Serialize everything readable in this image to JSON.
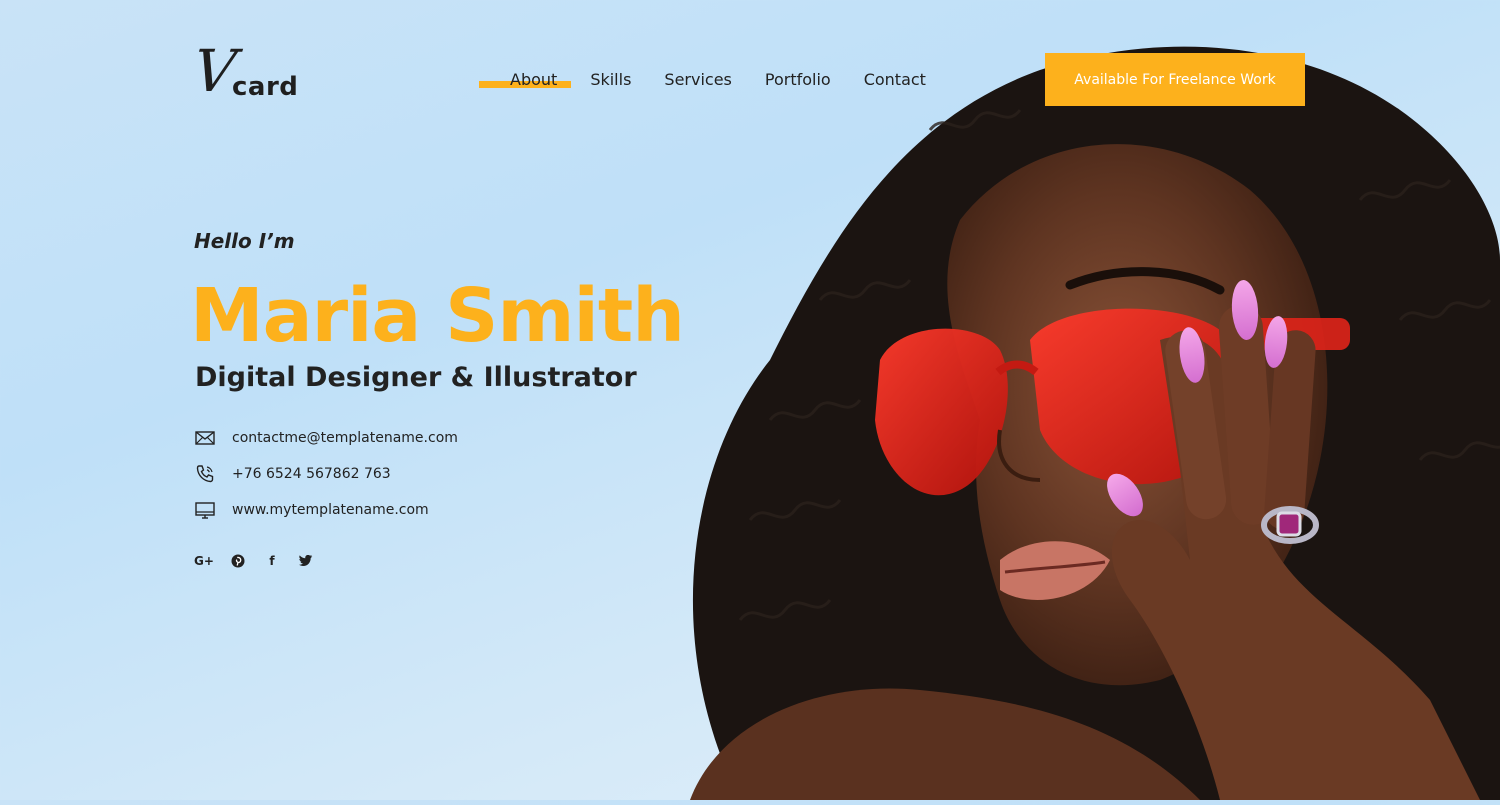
{
  "brand": {
    "logo_initial": "V",
    "logo_word": "card"
  },
  "nav": {
    "items": [
      {
        "label": "About",
        "active": true
      },
      {
        "label": "Skills",
        "active": false
      },
      {
        "label": "Services",
        "active": false
      },
      {
        "label": "Portfolio",
        "active": false
      },
      {
        "label": "Contact",
        "active": false
      }
    ]
  },
  "cta": {
    "label": "Available For Freelance Work"
  },
  "hero": {
    "greeting": "Hello I’m",
    "name": "Maria Smith",
    "role": "Digital Designer & Illustrator"
  },
  "contact": {
    "email": "contactme@templatename.com",
    "phone": "+76 6524 567862 763",
    "website": "www.mytemplatename.com"
  },
  "social": [
    {
      "icon": "google-plus-icon",
      "glyph": "G+"
    },
    {
      "icon": "pinterest-icon"
    },
    {
      "icon": "facebook-icon",
      "glyph": "f"
    },
    {
      "icon": "twitter-icon"
    }
  ],
  "colors": {
    "accent": "#fdb11c",
    "text_dark": "#222222",
    "sky": "#c9e3f7"
  }
}
